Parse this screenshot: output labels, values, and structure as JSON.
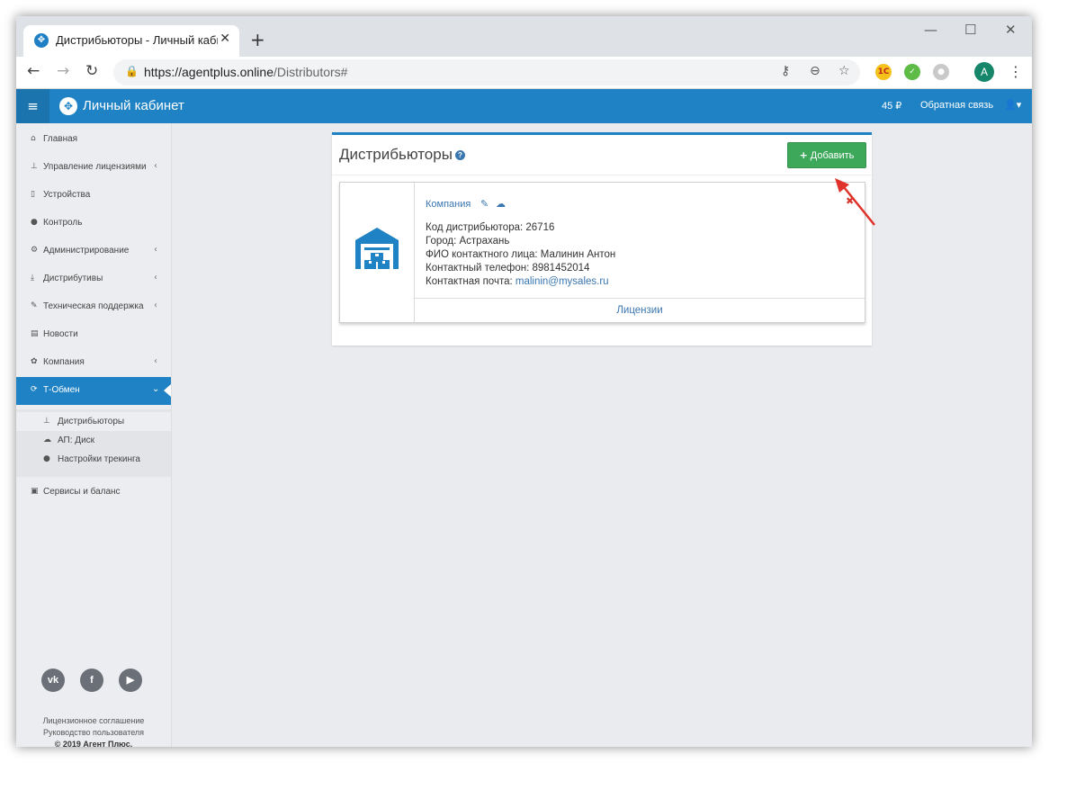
{
  "browser": {
    "tab_title": "Дистрибьюторы - Личный кабинет",
    "url_host": "https://agentplus.online",
    "url_path": "/Distributors#",
    "profile_letter": "A",
    "ext_1c_label": "1С"
  },
  "header": {
    "title": "Личный кабинет",
    "balance": "45 ₽",
    "feedback": "Обратная связь"
  },
  "sidebar": {
    "items": [
      {
        "label": "Главная",
        "icon": "home-icon"
      },
      {
        "label": "Управление лицензиями",
        "icon": "sitemap-icon"
      },
      {
        "label": "Устройства",
        "icon": "mobile-icon"
      },
      {
        "label": "Контроль",
        "icon": "globe-icon"
      },
      {
        "label": "Администрирование",
        "icon": "gears-icon"
      },
      {
        "label": "Дистрибутивы",
        "icon": "download-icon"
      },
      {
        "label": "Техническая поддержка",
        "icon": "wrench-icon"
      },
      {
        "label": "Новости",
        "icon": "newspaper-icon"
      },
      {
        "label": "Компания",
        "icon": "gear-icon"
      },
      {
        "label": "Т-Обмен",
        "icon": "refresh-icon"
      }
    ],
    "subitems": [
      {
        "label": "Дистрибьюторы",
        "icon": "sitemap-icon"
      },
      {
        "label": "АП: Диск",
        "icon": "cloud-icon"
      },
      {
        "label": "Настройки трекинга",
        "icon": "globe-icon"
      }
    ],
    "services": "Сервисы и баланс",
    "footer": {
      "license": "Лицензионное соглашение",
      "guide": "Руководство пользователя",
      "copyright": "© 2019 Агент Плюс."
    }
  },
  "main": {
    "title": "Дистрибьюторы",
    "add_button": "Добавить",
    "card": {
      "company": "Компания",
      "code": "Код дистрибьютора: 26716",
      "city": "Город: Астрахань",
      "contact": "ФИО контактного лица: Малинин Антон",
      "phone": "Контактный телефон: 8981452014",
      "email_label": "Контактная почта: ",
      "email": "malinin@mysales.ru",
      "licenses": "Лицензии"
    }
  },
  "colors": {
    "brand_blue": "#1f82c4",
    "add_green": "#3da85a",
    "link_blue": "#3a76b0",
    "annotation_red": "#e0322a"
  }
}
